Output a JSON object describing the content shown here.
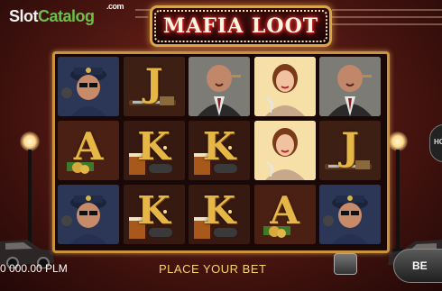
{
  "watermark": {
    "part1": "Slot",
    "part2": "Catalog",
    "part3": ".com"
  },
  "game": {
    "title": "MAFIA LOOT"
  },
  "reels": [
    [
      "policeman",
      "A",
      "policeman"
    ],
    [
      "J",
      "K",
      "K"
    ],
    [
      "boss",
      "K",
      "K"
    ],
    [
      "lady",
      "lady",
      "A"
    ],
    [
      "boss",
      "J",
      "policeman"
    ]
  ],
  "footer": {
    "balance": "0 000.00 PLM",
    "status": "PLACE YOUR BET",
    "bet_label": "BE",
    "hold_label": "HOL"
  }
}
